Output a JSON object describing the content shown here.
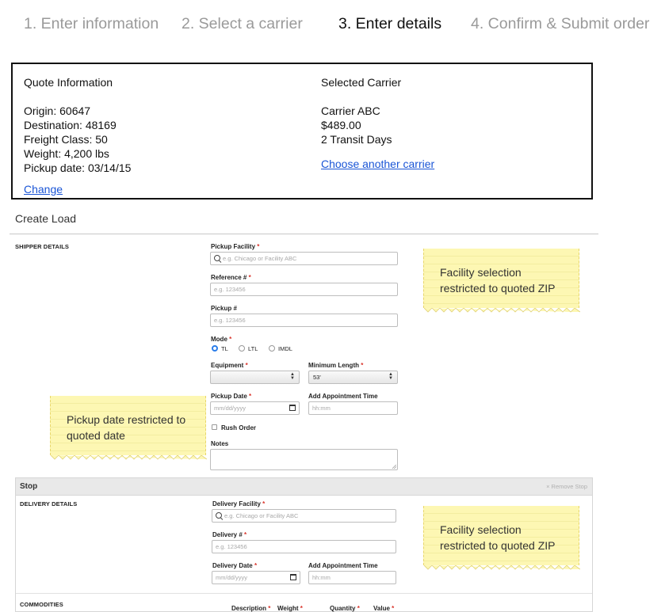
{
  "steps": [
    {
      "label": "1. Enter information"
    },
    {
      "label": "2. Select a carrier"
    },
    {
      "label": "3. Enter details"
    },
    {
      "label": "4. Confirm & Submit order"
    }
  ],
  "quote": {
    "heading": "Quote Information",
    "origin": "Origin: 60647",
    "destination": "Destination: 48169",
    "freight_class": "Freight Class: 50",
    "weight": "Weight: 4,200 lbs",
    "pickup_date": "Pickup date: 03/14/15",
    "change_link": "Change"
  },
  "carrier": {
    "heading": "Selected Carrier",
    "name": "Carrier ABC",
    "price": "$489.00",
    "transit": "2 Transit Days",
    "choose_link": "Choose another carrier"
  },
  "create_load": {
    "title": "Create Load"
  },
  "shipper": {
    "section_label": "SHIPPER DETAILS",
    "pickup_facility": {
      "label": "Pickup Facility",
      "placeholder": "e.g. Chicago or Facility ABC"
    },
    "reference": {
      "label": "Reference #",
      "placeholder": "e.g. 123456"
    },
    "pickup_num": {
      "label": "Pickup #",
      "placeholder": "e.g. 123456"
    },
    "mode": {
      "label": "Mode",
      "options": [
        "TL",
        "LTL",
        "IMDL"
      ],
      "selected": "TL"
    },
    "equipment": {
      "label": "Equipment",
      "value": ""
    },
    "min_length": {
      "label": "Minimum Length",
      "value": "53'"
    },
    "pickup_date": {
      "label": "Pickup Date",
      "placeholder": "mm/dd/yyyy"
    },
    "appt_time": {
      "label": "Add Appointment Time",
      "placeholder": "hh:mm"
    },
    "rush_order": {
      "label": "Rush Order",
      "checked": false
    },
    "notes": {
      "label": "Notes"
    }
  },
  "notes_callouts": {
    "facility_shipper": [
      "Facility selection",
      "restricted to quoted ZIP"
    ],
    "pickup_date": [
      "Pickup date restricted to",
      "quoted date"
    ],
    "facility_delivery": [
      "Facility selection",
      "restricted to quoted ZIP"
    ]
  },
  "stop": {
    "title": "Stop",
    "remove_label": "Remove Stop",
    "remove_icon": "×",
    "section_label": "DELIVERY DETAILS",
    "delivery_facility": {
      "label": "Delivery Facility",
      "placeholder": "e.g. Chicago or Facility ABC"
    },
    "delivery_num": {
      "label": "Delivery #",
      "placeholder": "e.g. 123456"
    },
    "delivery_date": {
      "label": "Delivery Date",
      "placeholder": "mm/dd/yyyy"
    },
    "appt_time": {
      "label": "Add Appointment Time",
      "placeholder": "hh:mm"
    }
  },
  "commodities": {
    "section_label": "COMMODITIES",
    "columns": [
      "Description",
      "Weight",
      "Quantity",
      "Value"
    ]
  },
  "colors": {
    "link": "#1a55d6",
    "required": "#d9342b",
    "radio_selected": "#2b7de9",
    "note_bg": "#fdf7b3"
  }
}
